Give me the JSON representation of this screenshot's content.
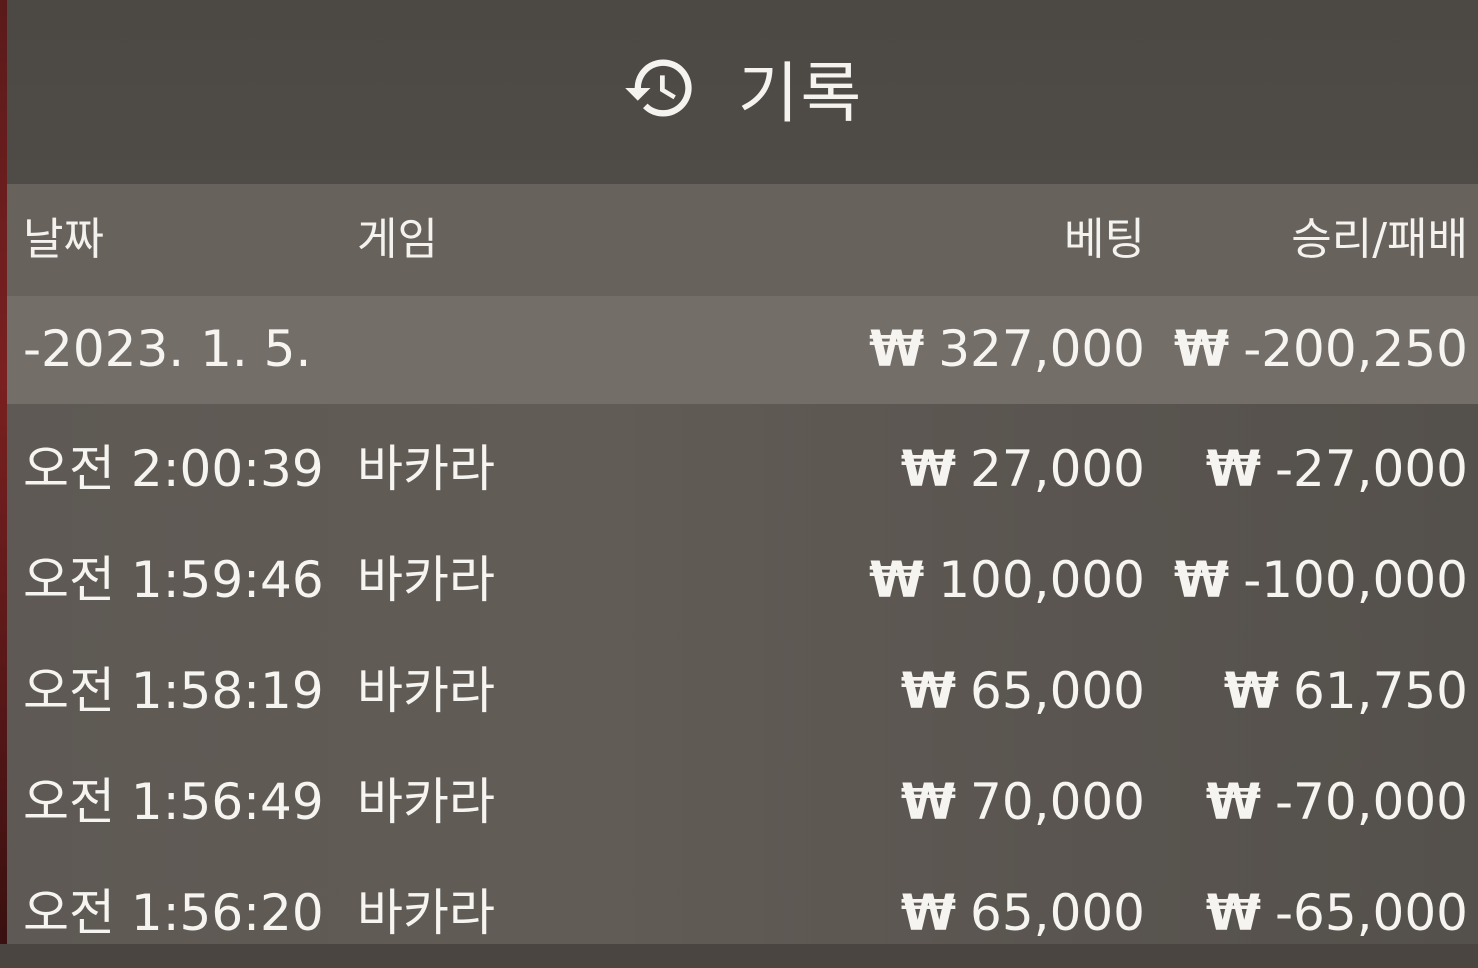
{
  "header": {
    "icon": "history-icon",
    "title": "기록"
  },
  "columns": {
    "date": "날짜",
    "game": "게임",
    "bet": "베팅",
    "result": "승리/패배"
  },
  "summary": {
    "date": "-2023. 1. 5.",
    "currency": "₩",
    "bet": "327,000",
    "result": "-200,250"
  },
  "rows": [
    {
      "time": "오전 2:00:39",
      "game": "바카라",
      "bet": "27,000",
      "result": "-27,000"
    },
    {
      "time": "오전 1:59:46",
      "game": "바카라",
      "bet": "100,000",
      "result": "-100,000"
    },
    {
      "time": "오전 1:58:19",
      "game": "바카라",
      "bet": "65,000",
      "result": "61,750"
    },
    {
      "time": "오전 1:56:49",
      "game": "바카라",
      "bet": "70,000",
      "result": "-70,000"
    },
    {
      "time": "오전 1:56:20",
      "game": "바카라",
      "bet": "65,000",
      "result": "-65,000"
    }
  ],
  "colors": {
    "panel": "#5e5954",
    "header": "#4c4844",
    "column_header_row": "#68625c",
    "date_row": "#746e68",
    "text": "#f2f0ec"
  }
}
